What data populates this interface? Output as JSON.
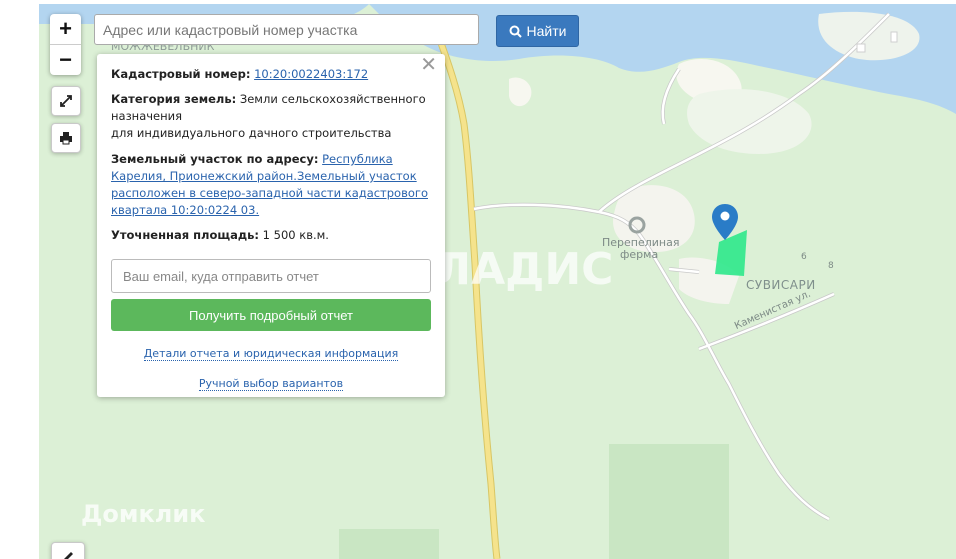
{
  "search": {
    "placeholder": "Адрес или кадастровый номер участка",
    "button_label": "Найти"
  },
  "zoom": {
    "in_label": "+",
    "out_label": "−"
  },
  "panel": {
    "cadastral_label": "Кадастровый номер:",
    "cadastral_value": "10:20:0022403:172",
    "category_label": "Категория земель:",
    "category_value_1": "Земли сельскохозяйственного назначения",
    "category_value_2": "для индивидуального дачного строительства",
    "address_label": "Земельный участок по адресу:",
    "address_value": "Республика Карелия, Прионежский район.Земельный участок расположен в северо-западной части кадастрового квартала 10:20:0224 03.",
    "area_label": "Уточненная площадь:",
    "area_value": "1 500 кв.м.",
    "email_placeholder": "Ваш email, куда отправить отчет",
    "report_button": "Получить подробный отчет",
    "details_link": "Детали отчета и юридическая информация",
    "manual_link": "Ручной выбор вариантов"
  },
  "map_labels": {
    "poi_name_1": "Перепелиная",
    "poi_name_2": "ферма",
    "settlement": "СУВИСАРИ",
    "street": "Каменистая ул.",
    "house_6": "6",
    "house_8": "8",
    "north_label": "МОЖЖЕВЕЛЬНИК"
  },
  "watermarks": {
    "vladis": "ВЛАДИС",
    "domclick": "Домклик"
  },
  "colors": {
    "water": "#b3d5f0",
    "land": "#dcf0d6",
    "road_main": "#f5e38c",
    "parcel": "#2ee88b",
    "marker": "#2a7cc7",
    "report_button": "#5cb85c",
    "search_button": "#3a79be"
  }
}
